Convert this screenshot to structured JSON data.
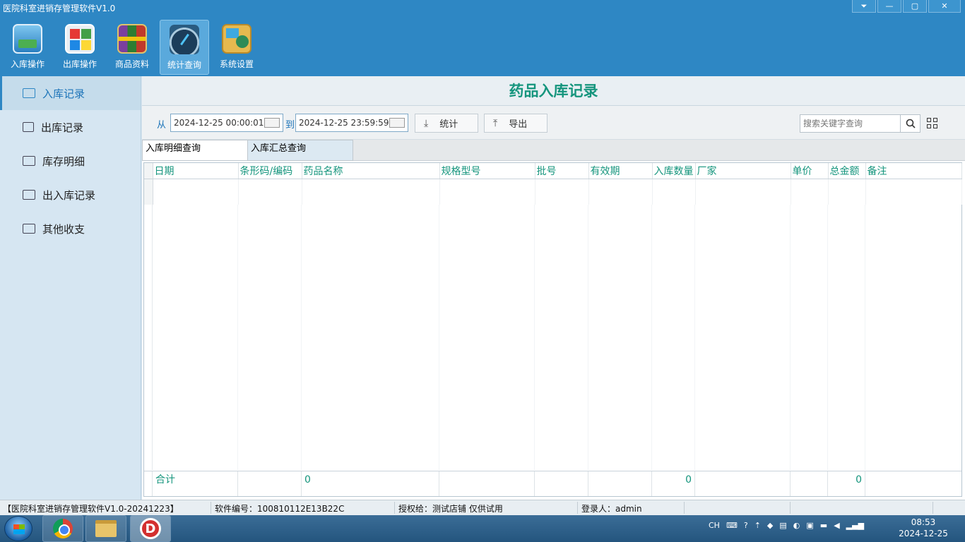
{
  "window": {
    "title": "医院科室进销存管理软件V1.0",
    "controls": {
      "dropdown": "⏷",
      "minimize": "—",
      "maximize": "▢",
      "close": "✕"
    }
  },
  "toolbar": {
    "items": [
      {
        "label": "入库操作",
        "icon": "truck-icon"
      },
      {
        "label": "出库操作",
        "icon": "color-grid-icon"
      },
      {
        "label": "商品资料",
        "icon": "books-icon"
      },
      {
        "label": "统计查询",
        "icon": "gauge-icon",
        "active": true
      },
      {
        "label": "系统设置",
        "icon": "settings-box-icon"
      }
    ]
  },
  "sidebar": {
    "items": [
      {
        "label": "入库记录",
        "icon": "inbox-icon",
        "active": true
      },
      {
        "label": "出库记录",
        "icon": "video-icon"
      },
      {
        "label": "库存明细",
        "icon": "briefcase-icon"
      },
      {
        "label": "出入库记录",
        "icon": "list-icon"
      },
      {
        "label": "其他收支",
        "icon": "image-icon"
      }
    ]
  },
  "main": {
    "title": "药品入库记录",
    "filter": {
      "from_label": "从",
      "from_value": "2024-12-25 00:00:01",
      "to_label": "到",
      "to_value": "2024-12-25 23:59:59",
      "stat_button": "统计",
      "export_button": "导出",
      "search_placeholder": "搜索关键字查询"
    },
    "tabs": [
      {
        "label": "入库明细查询",
        "active": true
      },
      {
        "label": "入库汇总查询",
        "active": false
      }
    ],
    "table": {
      "columns": [
        "日期",
        "条形码/编码",
        "药品名称",
        "规格型号",
        "批号",
        "有效期",
        "入库数量",
        "厂家",
        "单价",
        "总金额",
        "备注"
      ],
      "rows": [],
      "totals": {
        "label": "合计",
        "drug_name": "0",
        "quantity": "0",
        "amount": "0"
      }
    }
  },
  "statusbar": {
    "version": "【医院科室进销存管理软件V1.0-20241223】",
    "serial": "软件编号：100810112E13B22C",
    "license": "授权给：测试店铺 仅供试用",
    "user": "登录人：admin"
  },
  "taskbar": {
    "apps": [
      "chrome-icon",
      "file-explorer-icon",
      "d-app-icon"
    ],
    "tray": {
      "lang": "CH"
    },
    "clock": {
      "time": "08:53",
      "date": "2024-12-25"
    }
  }
}
